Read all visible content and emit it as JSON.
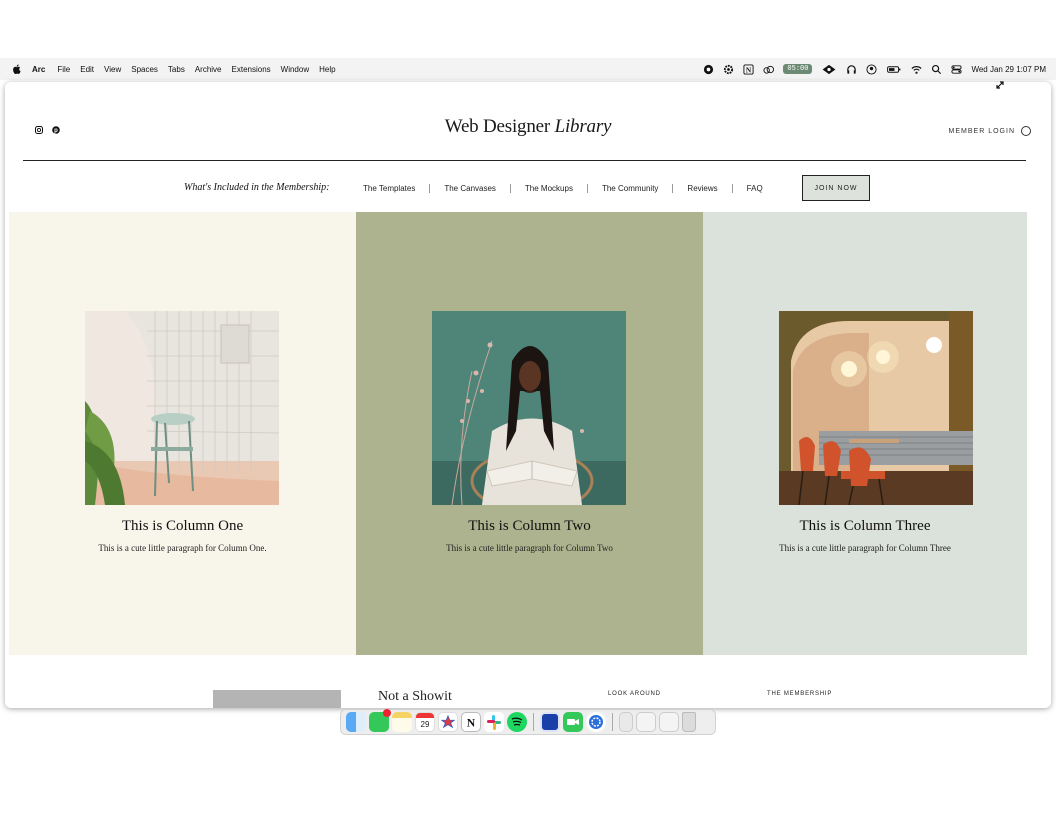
{
  "menubar": {
    "app_name": "Arc",
    "items": [
      "File",
      "Edit",
      "View",
      "Spaces",
      "Tabs",
      "Archive",
      "Extensions",
      "Window",
      "Help"
    ],
    "timer": "05:00",
    "datetime": "Wed Jan 29  1:07 PM"
  },
  "site": {
    "logo_main": "Web Designer ",
    "logo_italic": "Library",
    "member_login": "MEMBER LOGIN",
    "nav_label": "What's Included in the Membership:",
    "nav_links": [
      "The Templates",
      "The Canvases",
      "The Mockups",
      "The Community",
      "Reviews",
      "FAQ"
    ],
    "join_button": "JOIN NOW"
  },
  "columns": [
    {
      "title": "This is Column One",
      "text": "This is a cute little paragraph for Column One.",
      "bg": "#f8f6ea"
    },
    {
      "title": "This is Column Two",
      "text": "This is a cute little paragraph for Column Two",
      "bg": "#adb38f"
    },
    {
      "title": "This is Column Three",
      "text": "This is a cute little paragraph for Column Three",
      "bg": "#dbe1db"
    }
  ],
  "footer": {
    "heading": "Not a Showit",
    "look_around": "LOOK AROUND",
    "the_membership": "THE MEMBERSHIP"
  },
  "dock": {
    "calendar_day": "29",
    "apps": [
      "finder-icon",
      "messages-icon",
      "notes-icon",
      "calendar-icon",
      "spark-icon",
      "notion-icon",
      "slack-icon",
      "spotify-icon",
      "xcode-icon",
      "facetime-icon",
      "settings-icon"
    ]
  }
}
